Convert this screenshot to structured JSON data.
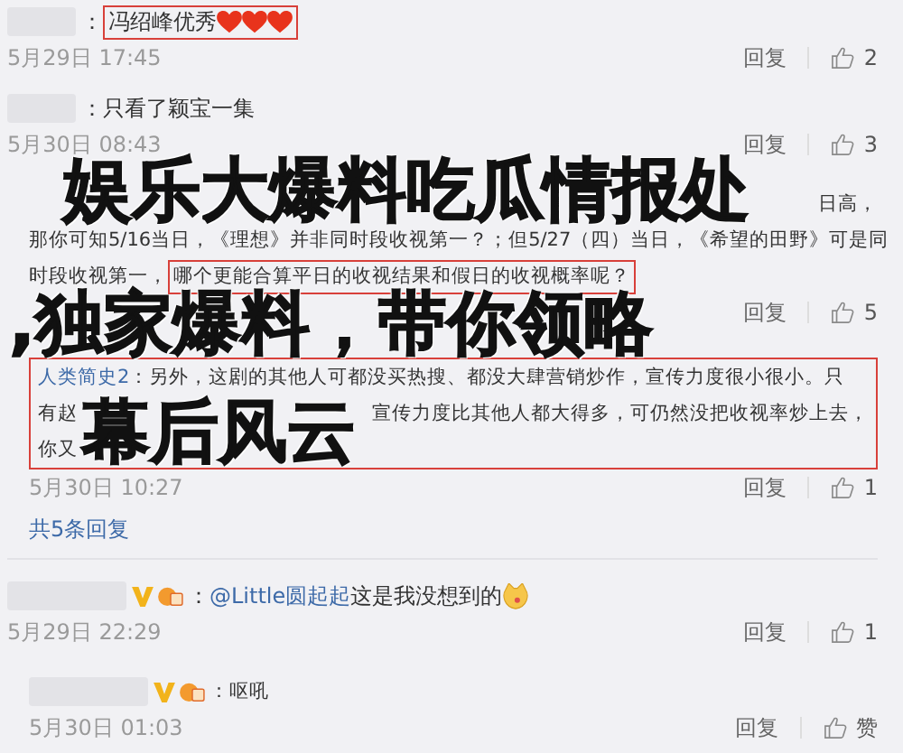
{
  "comments": [
    {
      "name_blurred": true,
      "verified": false,
      "boxed": false,
      "lines": [
        {
          "kind": "full",
          "parts": [
            {
              "kind": "plain",
              "text": "："
            },
            {
              "kind": "boxed",
              "parts": [
                {
                  "kind": "plain",
                  "text": "冯绍峰优秀"
                },
                {
                  "kind": "heart"
                },
                {
                  "kind": "heart"
                },
                {
                  "kind": "heart"
                }
              ]
            }
          ]
        }
      ],
      "date": "5月29日 17:45",
      "reply": "回复",
      "likes": "2"
    },
    {
      "name_blurred": true,
      "verified": false,
      "boxed": false,
      "lines": [
        {
          "kind": "full",
          "parts": [
            {
              "kind": "plain",
              "text": "：只看了颖宝一集"
            }
          ]
        }
      ],
      "date": "5月30日 08:43",
      "reply": "回复",
      "likes": "3",
      "children": [
        {
          "name_blurred": false,
          "verified": false,
          "boxed": false,
          "lines": [
            {
              "kind": "tail",
              "parts": [
                {
                  "kind": "plain",
                  "text": "日高，"
                }
              ]
            },
            {
              "kind": "full",
              "parts": [
                {
                  "kind": "plain",
                  "text": "那你可知5/16当日，《理想》并非同时段收视第一？；但5/27（四）当日，《希望的田野》可是同"
                }
              ]
            },
            {
              "kind": "full",
              "parts": [
                {
                  "kind": "plain",
                  "text": "时段收视第一，"
                },
                {
                  "kind": "boxed",
                  "parts": [
                    {
                      "kind": "plain",
                      "text": "哪个更能合算平日的收视结果和假日的收视概率呢？"
                    }
                  ]
                }
              ]
            }
          ],
          "reply": "回复",
          "likes": "5"
        },
        {
          "name_blurred": false,
          "verified": false,
          "boxed": true,
          "lines": [
            {
              "kind": "full",
              "parts": [
                {
                  "kind": "link",
                  "text": "人类简史2"
                },
                {
                  "kind": "plain",
                  "text": "：另外，这剧的其他人可都没买热搜、都没大肆营销炒作，宣传力度很小很小。只"
                }
              ]
            },
            {
              "kind": "split",
              "parts": [
                {
                  "kind": "plain",
                  "text": "有赵"
                },
                {
                  "kind": "plain",
                  "text": "宣传力度比其他人都大得多，可仍然没把收视率炒上去，"
                }
              ]
            },
            {
              "kind": "full",
              "parts": [
                {
                  "kind": "plain",
                  "text": "你又"
                }
              ]
            }
          ],
          "date": "5月30日 10:27",
          "reply": "回复",
          "likes": "1"
        }
      ],
      "more": "共5条回复"
    },
    {
      "name_blurred": true,
      "verified": true,
      "boxed": false,
      "lines": [
        {
          "kind": "full",
          "parts": [
            {
              "kind": "plain",
              "text": "："
            },
            {
              "kind": "link",
              "text": "@Little圆起起"
            },
            {
              "kind": "plain",
              "text": " 这是我没想到的"
            },
            {
              "kind": "dog"
            }
          ]
        }
      ],
      "date": "5月29日 22:29",
      "reply": "回复",
      "likes": "1",
      "children": [
        {
          "name_blurred": true,
          "verified": true,
          "boxed": false,
          "lines": [
            {
              "kind": "full",
              "parts": [
                {
                  "kind": "plain",
                  "text": "：呕吼"
                }
              ]
            }
          ],
          "date": "5月30日 01:03",
          "reply": "回复",
          "likes": "赞"
        }
      ]
    }
  ],
  "overlay_title": [
    "娱乐大爆料吃瓜情报处",
    ",独家爆料，带你领略",
    "幕后风云"
  ]
}
